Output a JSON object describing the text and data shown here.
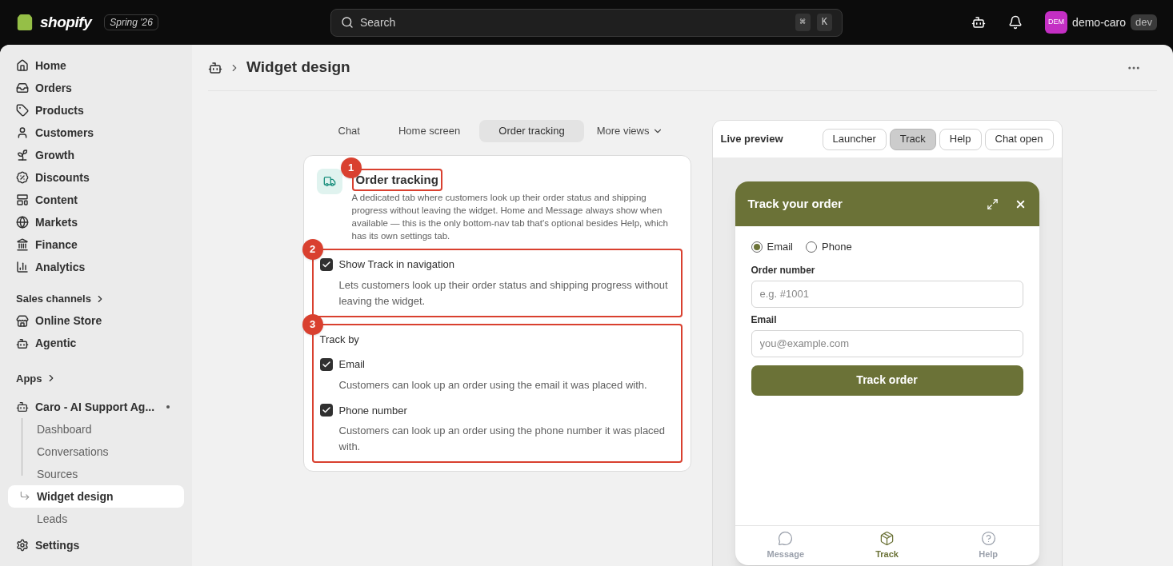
{
  "topbar": {
    "brand": "shopify",
    "release": "Spring '26",
    "search": {
      "placeholder": "Search",
      "keys": [
        "⌘",
        "K"
      ]
    },
    "store": {
      "initials": "DEM",
      "name": "demo-caro",
      "badge": "dev"
    }
  },
  "sidebar": {
    "items": [
      {
        "label": "Home",
        "selected": false
      },
      {
        "label": "Orders",
        "selected": false
      },
      {
        "label": "Products",
        "selected": false
      },
      {
        "label": "Customers",
        "selected": false
      },
      {
        "label": "Growth",
        "selected": false
      },
      {
        "label": "Discounts",
        "selected": false
      },
      {
        "label": "Content",
        "selected": false
      },
      {
        "label": "Markets",
        "selected": false
      },
      {
        "label": "Finance",
        "selected": false
      },
      {
        "label": "Analytics",
        "selected": false
      }
    ],
    "sales_channels": {
      "heading": "Sales channels",
      "items": [
        {
          "label": "Online Store",
          "selected": false
        },
        {
          "label": "Agentic",
          "selected": false
        }
      ]
    },
    "apps": {
      "heading": "Apps",
      "app": {
        "label": "Caro - AI Support Ag...",
        "children": [
          {
            "label": "Dashboard",
            "selected": false
          },
          {
            "label": "Conversations",
            "selected": false
          },
          {
            "label": "Sources",
            "selected": false
          },
          {
            "label": "Widget design",
            "selected": true
          },
          {
            "label": "Leads",
            "selected": false
          }
        ]
      }
    },
    "settings": {
      "label": "Settings",
      "selected": false
    }
  },
  "page": {
    "title": "Widget design",
    "tabs": [
      {
        "label": "Chat",
        "selected": false
      },
      {
        "label": "Home screen",
        "selected": false
      },
      {
        "label": "Order tracking",
        "selected": true
      }
    ],
    "more": "More views"
  },
  "settings_card": {
    "title": "Order tracking",
    "marker": "1",
    "description": "A dedicated tab where customers look up their order status and shipping progress without leaving the widget. Home and Message always show when available — this is the only bottom-nav tab that's optional besides Help, which has its own settings tab.",
    "sections": [
      {
        "kind": "single",
        "marker": "2",
        "options": [
          {
            "label": "Show Track in navigation",
            "checked": true,
            "help": "Lets customers look up their order status and shipping progress without leaving the widget."
          }
        ]
      },
      {
        "kind": "group",
        "marker": "3",
        "heading": "Track by",
        "options": [
          {
            "label": "Email",
            "checked": true,
            "help": "Customers can look up an order using the email it was placed with."
          },
          {
            "label": "Phone number",
            "checked": true,
            "help": "Customers can look up an order using the phone number it was placed with."
          }
        ]
      }
    ]
  },
  "preview": {
    "title": "Live preview",
    "views": [
      {
        "label": "Launcher",
        "selected": false
      },
      {
        "label": "Track",
        "selected": true
      },
      {
        "label": "Help",
        "selected": false
      },
      {
        "label": "Chat open",
        "selected": false
      }
    ],
    "widget": {
      "title": "Track your order",
      "methods": [
        {
          "label": "Email",
          "selected": true
        },
        {
          "label": "Phone",
          "selected": false
        }
      ],
      "fields": [
        {
          "label": "Order number",
          "placeholder": "e.g. #1001"
        },
        {
          "label": "Email",
          "placeholder": "you@example.com"
        }
      ],
      "submit": "Track order",
      "nav": [
        {
          "label": "Message",
          "selected": false
        },
        {
          "label": "Track",
          "selected": true
        },
        {
          "label": "Help",
          "selected": false
        }
      ]
    }
  }
}
